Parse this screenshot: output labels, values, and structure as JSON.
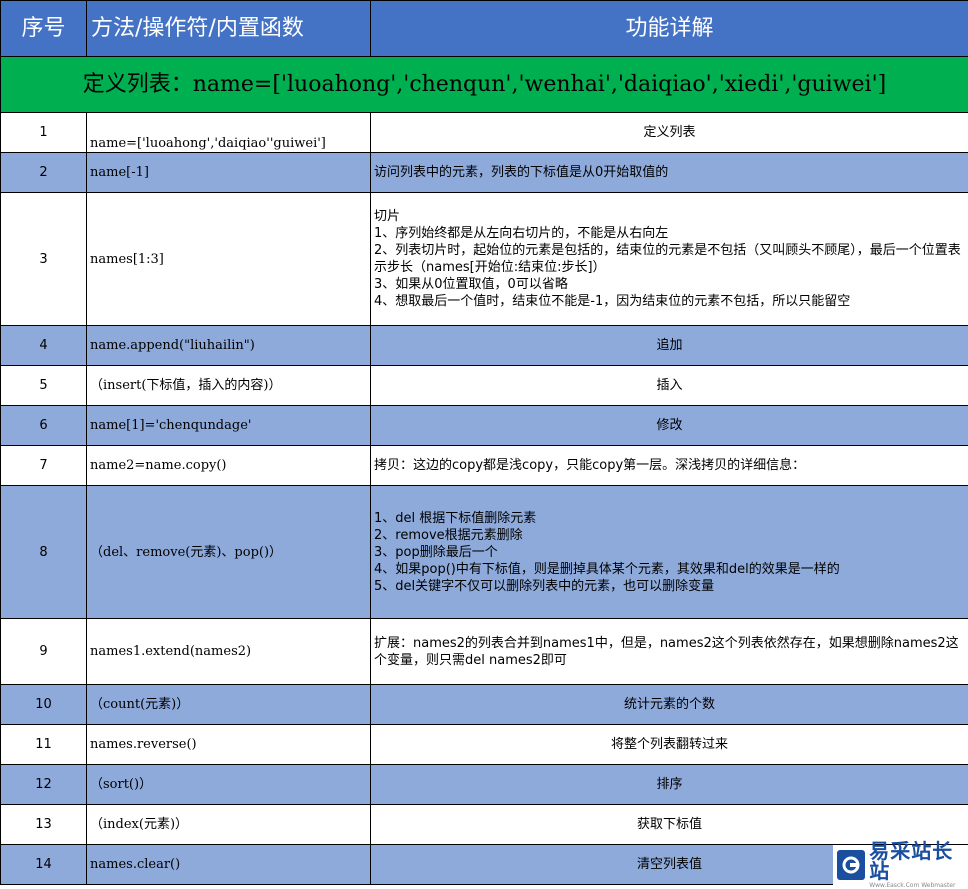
{
  "header": {
    "col_num": "序号",
    "col_method": "方法/操作符/内置函数",
    "col_desc": "功能详解"
  },
  "section": {
    "title": "定义列表：name=['luoahong','chenqun','wenhai','daiqiao','xiedi','guiwei']"
  },
  "rows": [
    {
      "num": "1",
      "method": "name=['luoahong','daiqiao''guiwei']",
      "desc": "定义列表"
    },
    {
      "num": "2",
      "method": "name[-1]",
      "desc": "访问列表中的元素，列表的下标值是从0开始取值的"
    },
    {
      "num": "3",
      "method": "names[1:3]",
      "desc": "切片\n1、序列始终都是从左向右切片的，不能是从右向左\n2、列表切片时，起始位的元素是包括的，结束位的元素是不包括（又叫顾头不顾尾），最后一个位置表示步长（names[开始位:结束位:步长]）\n3、如果从0位置取值，0可以省略\n4、想取最后一个值时，结束位不能是-1，因为结束位的元素不包括，所以只能留空"
    },
    {
      "num": "4",
      "method": "name.append(\"liuhailin\")",
      "desc": "追加"
    },
    {
      "num": "5",
      "method": "（insert(下标值，插入的内容)）",
      "desc": "插入"
    },
    {
      "num": "6",
      "method": "name[1]='chenqundage'",
      "desc": "修改"
    },
    {
      "num": "7",
      "method": "name2=name.copy()",
      "desc": "拷贝：这边的copy都是浅copy，只能copy第一层。深浅拷贝的详细信息："
    },
    {
      "num": "8",
      "method": "（del、remove(元素)、pop()）",
      "desc": "1、del 根据下标值删除元素\n2、remove根据元素删除\n3、pop删除最后一个\n4、如果pop()中有下标值，则是删掉具体某个元素，其效果和del的效果是一样的\n5、del关键字不仅可以删除列表中的元素，也可以删除变量"
    },
    {
      "num": "9",
      "method": "names1.extend(names2)",
      "desc": "扩展：names2的列表合并到names1中，但是，names2这个列表依然存在，如果想删除names2这个变量，则只需del names2即可"
    },
    {
      "num": "10",
      "method": "（count(元素)）",
      "desc": "统计元素的个数"
    },
    {
      "num": "11",
      "method": "names.reverse()",
      "desc": "将整个列表翻转过来"
    },
    {
      "num": "12",
      "method": "（sort()）",
      "desc": "排序"
    },
    {
      "num": "13",
      "method": "（index(元素)）",
      "desc": "获取下标值"
    },
    {
      "num": "14",
      "method": "names.clear()",
      "desc": "清空列表值"
    }
  ],
  "watermark": {
    "brand": "易采站长站",
    "url": "Www.Easck.Com Webmaster"
  },
  "colors": {
    "header_bg": "#4472c4",
    "section_bg": "#00b050",
    "row_alt_bg": "#8eaadb"
  }
}
